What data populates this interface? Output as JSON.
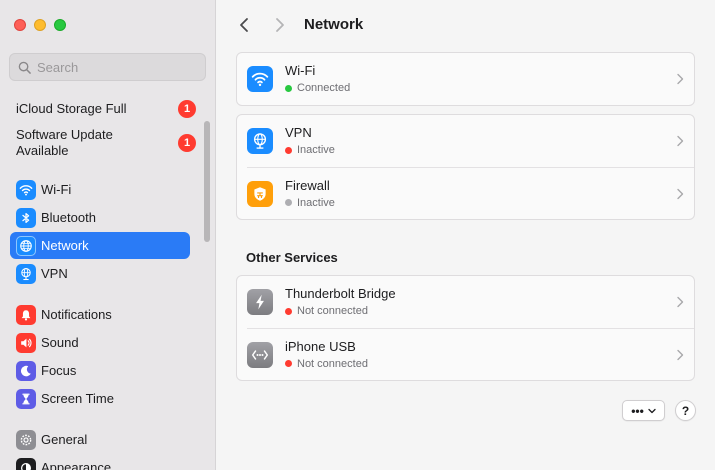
{
  "sidebar": {
    "search_placeholder": "Search",
    "alerts": [
      {
        "label": "iCloud Storage Full",
        "badge": "1"
      },
      {
        "label": "Software Update Available",
        "badge": "1"
      }
    ],
    "items": [
      {
        "label": "Wi-Fi",
        "icon": "wifi-icon",
        "color": "#1a8cff"
      },
      {
        "label": "Bluetooth",
        "icon": "bluetooth-icon",
        "color": "#1a8cff"
      },
      {
        "label": "Network",
        "icon": "globe-icon",
        "color": "#1a8cff",
        "active": true
      },
      {
        "label": "VPN",
        "icon": "vpn-globe-icon",
        "color": "#1a8cff"
      },
      {
        "label": "Notifications",
        "icon": "bell-icon",
        "color": "#ff3b30"
      },
      {
        "label": "Sound",
        "icon": "speaker-icon",
        "color": "#ff3b30"
      },
      {
        "label": "Focus",
        "icon": "moon-icon",
        "color": "#5e5ce6"
      },
      {
        "label": "Screen Time",
        "icon": "hourglass-icon",
        "color": "#5e5ce6"
      },
      {
        "label": "General",
        "icon": "gear-icon",
        "color": "#8e8e93"
      },
      {
        "label": "Appearance",
        "icon": "appearance-icon",
        "color": "#1d1d1f"
      }
    ]
  },
  "toolbar": {
    "title": "Network"
  },
  "services": [
    {
      "name": "Wi-Fi",
      "status": "Connected",
      "status_color": "#28c840",
      "icon": "wifi-icon",
      "icon_color": "#1a8cff"
    },
    {
      "name": "VPN",
      "status": "Inactive",
      "status_color": "#ff3b30",
      "icon": "vpn-globe-icon",
      "icon_color": "#1a8cff"
    },
    {
      "name": "Firewall",
      "status": "Inactive",
      "status_color": "#aeaeb2",
      "icon": "firewall-shield-icon",
      "icon_color": "#ff9f0a"
    }
  ],
  "other_services": {
    "title": "Other Services",
    "items": [
      {
        "name": "Thunderbolt Bridge",
        "status": "Not connected",
        "status_color": "#ff3b30",
        "icon": "thunderbolt-icon",
        "icon_color": "#8e8e93"
      },
      {
        "name": "iPhone USB",
        "status": "Not connected",
        "status_color": "#ff3b30",
        "icon": "usb-dots-icon",
        "icon_color": "#8e8e93"
      }
    ]
  },
  "footer": {
    "more_label": "•••",
    "help_label": "?"
  }
}
